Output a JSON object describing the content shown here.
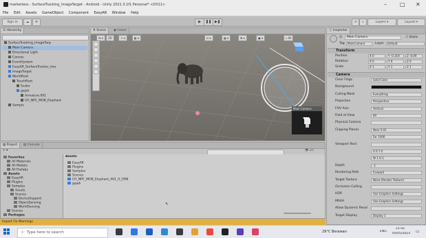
{
  "window": {
    "title": "markerless - SurfaceTracking_ImageTarget - Android - Unity 2021.3.1f1 Personal* <DX11>",
    "controls": [
      "–",
      "□",
      "✕"
    ]
  },
  "menu": [
    "File",
    "Edit",
    "Assets",
    "GameObject",
    "Component",
    "EasyAR",
    "Window",
    "Help"
  ],
  "toolbar": {
    "account": "Sign in",
    "search_icon": "search-icon",
    "layers_label": "Layers",
    "layout_label": "Layout"
  },
  "hierarchy": {
    "tab": "Hierarchy",
    "items": [
      {
        "label": "SurfaceTracking_ImageTarg",
        "depth": 0,
        "icon": "unity-scene-icon"
      },
      {
        "label": "Main Camera",
        "depth": 1,
        "selected": true
      },
      {
        "label": "Directional Light",
        "depth": 1
      },
      {
        "label": "Canvas",
        "depth": 1
      },
      {
        "label": "EventSystem",
        "depth": 1
      },
      {
        "label": "EasyAR_SurfaceTracker_ima",
        "depth": 1,
        "blue": true
      },
      {
        "label": "ImageTarget",
        "depth": 1,
        "blue": true
      },
      {
        "label": "WorldRoot",
        "depth": 1,
        "blue": true
      },
      {
        "label": "TouchRoot",
        "depth": 2
      },
      {
        "label": "Scaler",
        "depth": 3
      },
      {
        "label": "gajah",
        "depth": 3,
        "blue": true
      },
      {
        "label": "Armature.001",
        "depth": 4
      },
      {
        "label": "CH_NPC_MOB_Elephant",
        "depth": 4
      },
      {
        "label": "Sample",
        "depth": 1
      }
    ]
  },
  "scene": {
    "tabs": [
      "Scene",
      "Game"
    ],
    "camera_preview_label": "Main Camera"
  },
  "project": {
    "tabs": [
      "Project",
      "Console"
    ],
    "left_items": [
      {
        "label": "Favorites",
        "depth": 0,
        "bold": true
      },
      {
        "label": "All Materials",
        "depth": 1
      },
      {
        "label": "All Models",
        "depth": 1
      },
      {
        "label": "All Prefabs",
        "depth": 1
      },
      {
        "label": "Assets",
        "depth": 0,
        "bold": true
      },
      {
        "label": "EasyAR",
        "depth": 1
      },
      {
        "label": "Plugins",
        "depth": 1
      },
      {
        "label": "Samples",
        "depth": 1
      },
      {
        "label": "Assets",
        "depth": 2
      },
      {
        "label": "Scenes",
        "depth": 2
      },
      {
        "label": "DeviceSupport",
        "depth": 3
      },
      {
        "label": "ObjectSensing",
        "depth": 3
      },
      {
        "label": "WorldSensing",
        "depth": 3
      },
      {
        "label": "Scenes",
        "depth": 1
      },
      {
        "label": "Packages",
        "depth": 0,
        "bold": true
      }
    ],
    "breadcrumb": "Assets",
    "assets": [
      "EasyAR",
      "Plugins",
      "Samples",
      "Scenes",
      "CH_NPC_MOB_Elephant_A01_0_GRN",
      "gajah"
    ],
    "counter": "27"
  },
  "console_strip": "Import Fix Warnings",
  "inspector": {
    "tab": "Inspector",
    "object_name": "Main Camera",
    "static_label": "Static",
    "tag_label": "Tag",
    "tag_value": "MainCamera",
    "layer_label": "Layer",
    "layer_value": "Default",
    "transform": {
      "title": "Transform",
      "position": {
        "label": "Position",
        "x": "0",
        "y": "-0.319",
        "z": "-0.09"
      },
      "rotation": {
        "label": "Rotation",
        "x": "0",
        "y": "0",
        "z": "0"
      },
      "scale": {
        "label": "Scale",
        "x": "1",
        "y": "1",
        "z": "1"
      }
    },
    "camera": {
      "title": "Camera",
      "rows": [
        {
          "key": "Clear Flags",
          "value": "Solid Color"
        },
        {
          "key": "Background",
          "value": ""
        },
        {
          "key": "Culling Mask",
          "value": "Everything"
        },
        {
          "key": "Projection",
          "value": "Perspective"
        },
        {
          "key": "FOV Axis",
          "value": "Vertical"
        },
        {
          "key": "Field of View",
          "value": "60"
        },
        {
          "key": "Physical Camera",
          "value": ""
        },
        {
          "key": "Clipping Planes",
          "value": "Near  0.01"
        },
        {
          "key": "",
          "value": "Far  1000"
        },
        {
          "key": "Viewport Rect",
          "value": ""
        },
        {
          "key": "",
          "value": "X 0        Y 0"
        },
        {
          "key": "",
          "value": "W 1        H 1"
        },
        {
          "key": "Depth",
          "value": "-1"
        },
        {
          "key": "Rendering Path",
          "value": "Forward"
        },
        {
          "key": "Target Texture",
          "value": "None (Render Texture)"
        },
        {
          "key": "Occlusion Culling",
          "value": ""
        },
        {
          "key": "HDR",
          "value": "Use Graphics Settings"
        },
        {
          "key": "MSAA",
          "value": "Use Graphics Settings"
        },
        {
          "key": "Allow Dynamic Resol",
          "value": ""
        },
        {
          "key": "Target Display",
          "value": "Display 1"
        }
      ]
    }
  },
  "taskbar": {
    "search_placeholder": "Type here to search",
    "weather": "29°C  Berawan",
    "lang": "ENG",
    "time": "21:42",
    "date": "05/05/2023"
  }
}
